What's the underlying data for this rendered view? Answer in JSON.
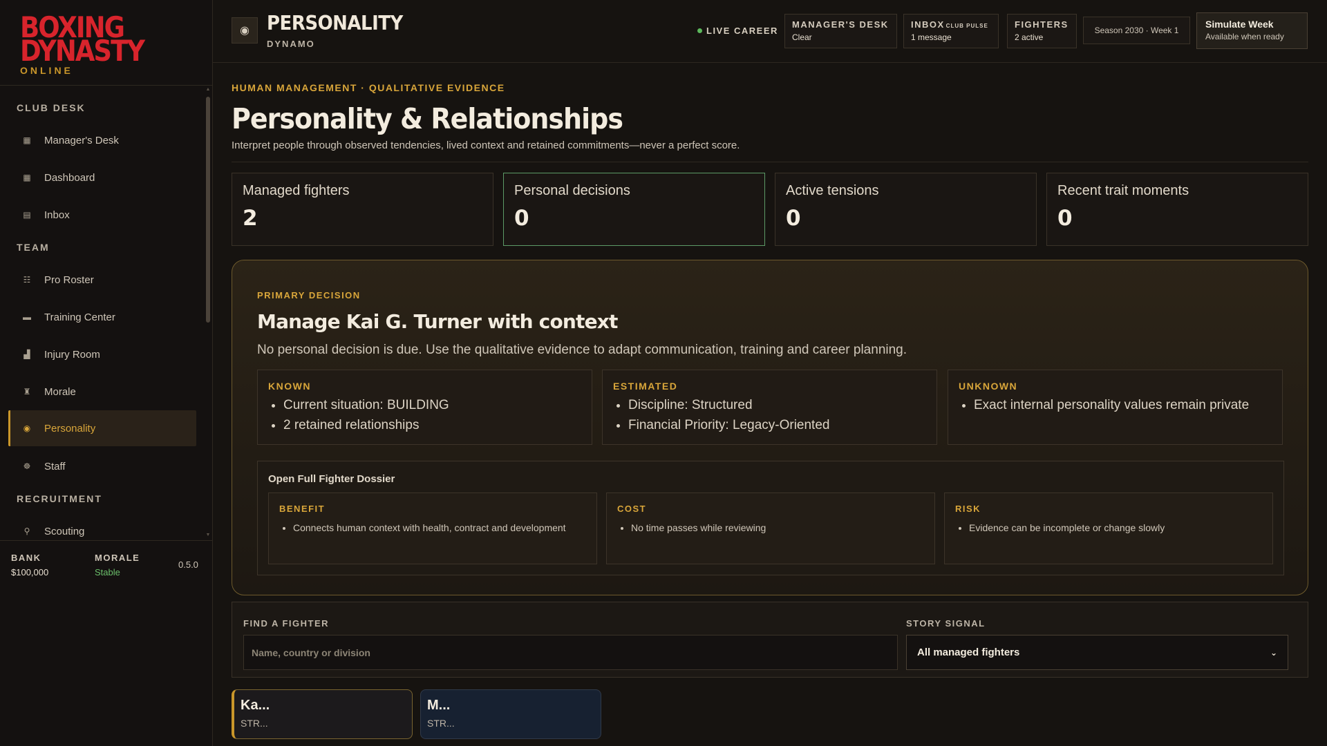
{
  "logo": {
    "title": "BOXING DYNASTY",
    "subtitle": "ONLINE"
  },
  "sidebar": {
    "sections": [
      {
        "label": "CLUB DESK"
      },
      {
        "label": "TEAM"
      },
      {
        "label": "RECRUITMENT"
      }
    ],
    "items": [
      {
        "label": "Manager's Desk",
        "icon": "desk-icon",
        "glyph": "▦"
      },
      {
        "label": "Dashboard",
        "icon": "dashboard-icon",
        "glyph": "▦"
      },
      {
        "label": "Inbox",
        "icon": "inbox-icon",
        "glyph": "▤"
      },
      {
        "label": "Pro Roster",
        "icon": "roster-icon",
        "glyph": "☷"
      },
      {
        "label": "Training Center",
        "icon": "training-icon",
        "glyph": "▬"
      },
      {
        "label": "Injury Room",
        "icon": "injury-icon",
        "glyph": "▟"
      },
      {
        "label": "Morale",
        "icon": "morale-icon",
        "glyph": "♜"
      },
      {
        "label": "Personality",
        "icon": "personality-icon",
        "glyph": "◉"
      },
      {
        "label": "Staff",
        "icon": "staff-icon",
        "glyph": "☸"
      },
      {
        "label": "Scouting",
        "icon": "scouting-icon",
        "glyph": "⚲"
      }
    ],
    "active_item": "Personality",
    "footer": {
      "bank_label": "BANK",
      "bank_value": "$100,000",
      "morale_label": "MORALE",
      "morale_value": "Stable",
      "version": "0.5.0"
    }
  },
  "header": {
    "title": "PERSONALITY",
    "subtitle": "DYNAMO",
    "live_label": "LIVE CAREER",
    "managers_desk": {
      "label": "MANAGER'S DESK",
      "value": "Clear"
    },
    "inbox": {
      "label": "INBOX",
      "tag": "CLUB PULSE",
      "value": "1 message"
    },
    "fighters": {
      "label": "FIGHTERS",
      "value": "2 active"
    },
    "season": "Season 2030 · Week 1",
    "simulate": {
      "label": "Simulate Week",
      "sub": "Available when ready"
    }
  },
  "main": {
    "eyebrow": "HUMAN MANAGEMENT · QUALITATIVE EVIDENCE",
    "title": "Personality & Relationships",
    "lede": "Interpret people through observed tendencies, lived context and retained commitments—never a perfect score.",
    "stats": [
      {
        "label": "Managed fighters",
        "value": "2"
      },
      {
        "label": "Personal decisions",
        "value": "0"
      },
      {
        "label": "Active tensions",
        "value": "0"
      },
      {
        "label": "Recent trait moments",
        "value": "0"
      }
    ],
    "decision": {
      "eyebrow": "PRIMARY DECISION",
      "title": "Manage Kai G. Turner with context",
      "desc": "No personal decision is due. Use the qualitative evidence to adapt communication, training and career planning.",
      "known": {
        "label": "KNOWN",
        "items": [
          "Current situation: BUILDING",
          "2 retained relationships"
        ]
      },
      "estimated": {
        "label": "ESTIMATED",
        "items": [
          "Discipline: Structured",
          "Financial Priority: Legacy-Oriented"
        ]
      },
      "unknown": {
        "label": "UNKNOWN",
        "items": [
          "Exact internal personality values remain private"
        ]
      },
      "dossier": {
        "title": "Open Full Fighter Dossier",
        "benefit": {
          "label": "BENEFIT",
          "items": [
            "Connects human context with health, contract and development"
          ]
        },
        "cost": {
          "label": "COST",
          "items": [
            "No time passes while reviewing"
          ]
        },
        "risk": {
          "label": "RISK",
          "items": [
            "Evidence can be incomplete or change slowly"
          ]
        }
      }
    },
    "filters": {
      "find_label": "FIND A FIGHTER",
      "find_placeholder": "Name, country or division",
      "signal_label": "STORY SIGNAL",
      "signal_value": "All managed fighters"
    },
    "fighters": [
      {
        "name": "Ka...",
        "style": "STR..."
      },
      {
        "name": "M...",
        "style": "STR..."
      }
    ]
  },
  "colors": {
    "accent": "#c9962a",
    "brand_red": "#d8242c",
    "success": "#5cb85c",
    "background": "#161310"
  }
}
